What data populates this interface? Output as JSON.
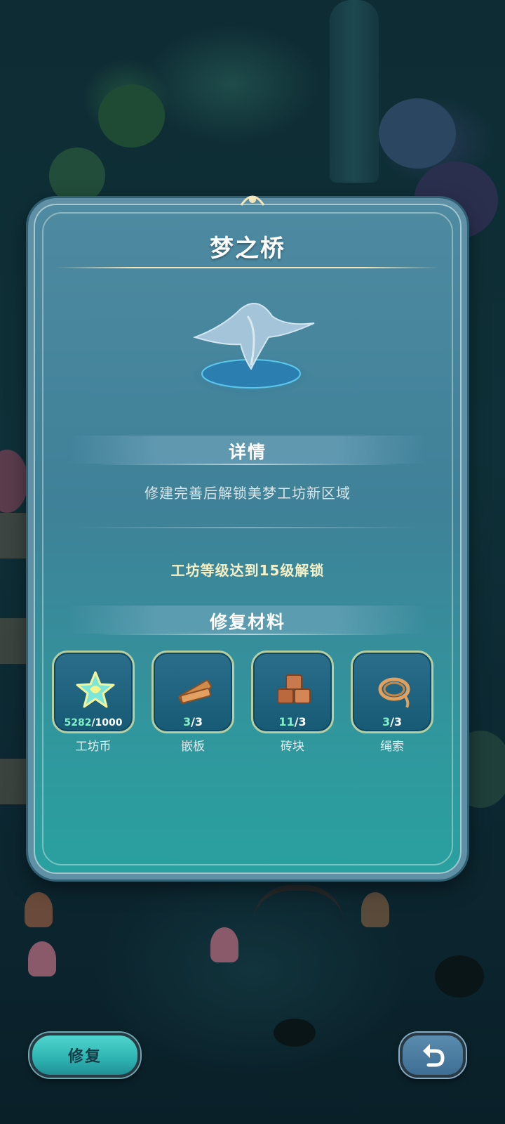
{
  "panel": {
    "title": "梦之桥",
    "details_heading": "详情",
    "description": "修建完善后解锁美梦工坊新区域",
    "unlock_requirement": "工坊等级达到15级解锁",
    "materials_heading": "修复材料"
  },
  "materials": [
    {
      "name": "工坊币",
      "have": "5282",
      "need": "/1000",
      "icon": "star-coin-icon"
    },
    {
      "name": "嵌板",
      "have": "3",
      "need": "/3",
      "icon": "wood-planks-icon"
    },
    {
      "name": "砖块",
      "have": "11",
      "need": "/3",
      "icon": "bricks-icon"
    },
    {
      "name": "绳索",
      "have": "3",
      "need": "/3",
      "icon": "rope-icon"
    }
  ],
  "buttons": {
    "repair_label": "修复",
    "back_icon": "undo-arrow-icon"
  },
  "colors": {
    "have_count": "#7ff0c3",
    "unlock_text": "#f7f0c6",
    "panel": "#3f8198"
  }
}
